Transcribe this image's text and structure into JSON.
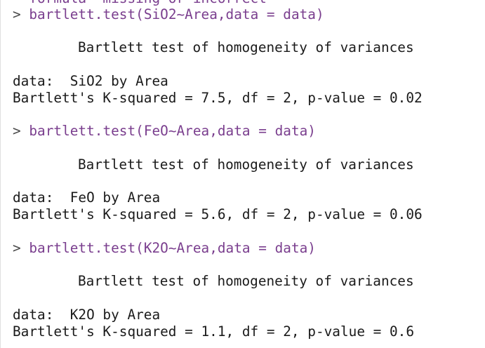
{
  "console": {
    "cut_line": "  formula' missing or incorrect",
    "blocks": [
      {
        "prompt": ">",
        "command": "bartlett.test(SiO2~Area,data = data)",
        "heading": "Bartlett test of homogeneity of variances",
        "data_line": "data:  SiO2 by Area",
        "result_line": "Bartlett's K-squared = 7.5, df = 2, p-value = 0.02"
      },
      {
        "prompt": ">",
        "command": "bartlett.test(FeO~Area,data = data)",
        "heading": "Bartlett test of homogeneity of variances",
        "data_line": "data:  FeO by Area",
        "result_line": "Bartlett's K-squared = 5.6, df = 2, p-value = 0.06"
      },
      {
        "prompt": ">",
        "command": "bartlett.test(K2O~Area,data = data)",
        "heading": "Bartlett test of homogeneity of variances",
        "data_line": "data:  K2O by Area",
        "result_line": "Bartlett's K-squared = 1.1, df = 2, p-value = 0.6"
      }
    ]
  },
  "colors": {
    "command": "#7a3e8e",
    "output": "#1a1a1a",
    "background": "#ffffff"
  }
}
